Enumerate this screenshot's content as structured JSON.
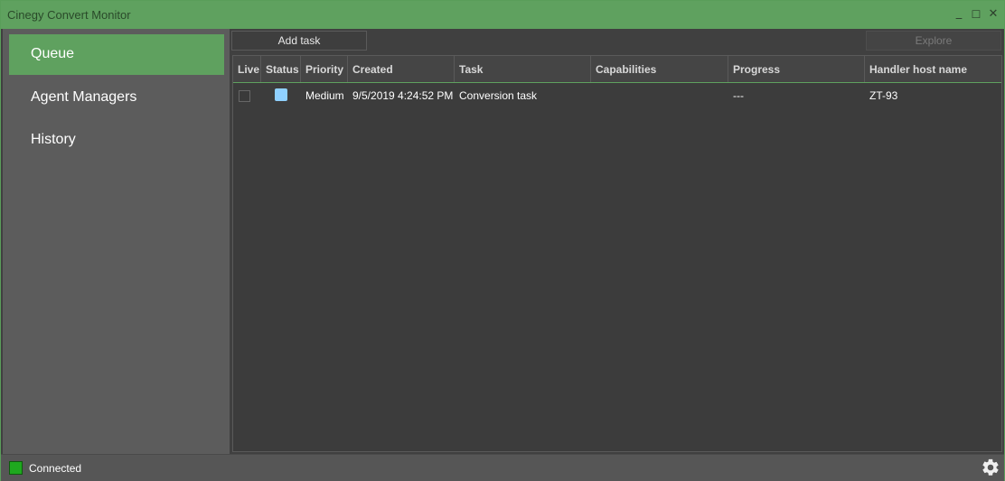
{
  "window": {
    "title": "Cinegy Convert Monitor"
  },
  "titlebar_buttons": {
    "minimize": "_",
    "maximize": "☐",
    "close": "✕"
  },
  "sidebar": {
    "items": [
      {
        "label": "Queue",
        "active": true
      },
      {
        "label": "Agent Managers",
        "active": false
      },
      {
        "label": "History",
        "active": false
      }
    ]
  },
  "toolbar": {
    "add_task_label": "Add task",
    "explore_label": "Explore"
  },
  "table": {
    "columns": [
      "Live",
      "Status",
      "Priority",
      "Created",
      "Task",
      "Capabilities",
      "Progress",
      "Handler host name"
    ],
    "rows": [
      {
        "live": false,
        "status_color": "#8fd0ff",
        "priority": "Medium",
        "created": "9/5/2019 4:24:52 PM",
        "task": "Conversion task",
        "capabilities": "",
        "progress": "---",
        "handler_host_name": "ZT-93"
      }
    ]
  },
  "statusbar": {
    "connection_label": "Connected",
    "connection_color": "#1fa81f",
    "settings_icon": "gear-icon"
  },
  "colors": {
    "accent": "#5fa15f",
    "background": "#404040",
    "sidebar": "#5c5c5c"
  }
}
